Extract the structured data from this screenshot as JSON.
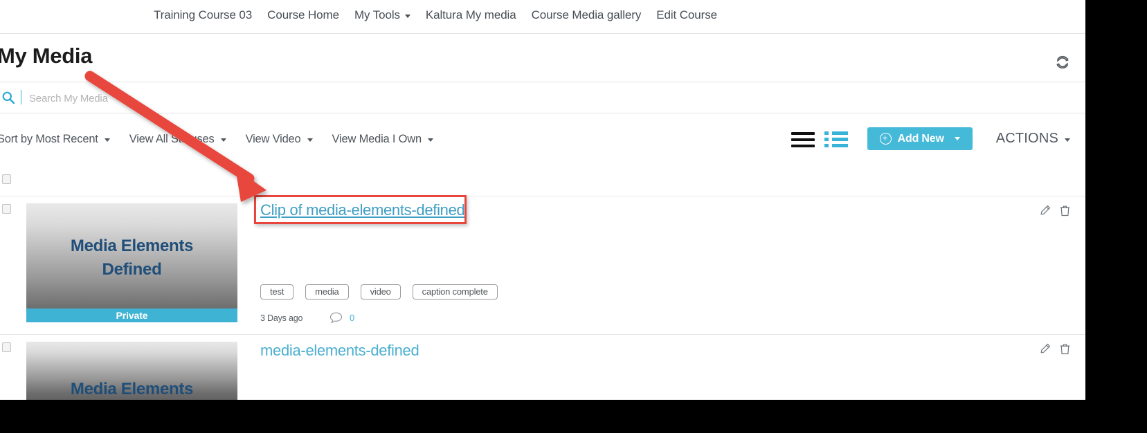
{
  "topnav": {
    "items": [
      {
        "label": "Training Course 03",
        "caret": false
      },
      {
        "label": "Course Home",
        "caret": false
      },
      {
        "label": "My Tools",
        "caret": true
      },
      {
        "label": "Kaltura My media",
        "caret": false
      },
      {
        "label": "Course Media gallery",
        "caret": false
      },
      {
        "label": "Edit Course",
        "caret": false
      }
    ]
  },
  "header": {
    "title": "My Media",
    "refresh_icon": "refresh-icon"
  },
  "search": {
    "icon": "search-icon",
    "placeholder": "Search My Media",
    "value": ""
  },
  "toolbar": {
    "filters": [
      {
        "label": "Sort by Most Recent"
      },
      {
        "label": "View All Statuses"
      },
      {
        "label": "View Video"
      },
      {
        "label": "View Media I Own"
      }
    ],
    "view_list_icon": "list-view-icon",
    "view_detail_icon": "detail-view-icon",
    "add_new_label": "Add New",
    "add_new_icon": "plus-circle-icon",
    "actions_label": "ACTIONS",
    "accent_color": "#45b9d8"
  },
  "media_items": [
    {
      "title": "Clip of media-elements-defined",
      "thumbnail_text": "Media Elements\nDefined",
      "thumbnail_line1": "Media Elements",
      "thumbnail_line2": "Defined",
      "privacy_badge": "Private",
      "tags": [
        "test",
        "media",
        "video",
        "caption complete"
      ],
      "date": "3 Days ago",
      "comment_count": "0",
      "comment_icon": "comment-bubble-icon",
      "edit_icon": "pencil-icon",
      "delete_icon": "trash-icon"
    },
    {
      "title": "media-elements-defined",
      "thumbnail_line1": "Media Elements",
      "edit_icon": "pencil-icon",
      "delete_icon": "trash-icon"
    }
  ],
  "annotation": {
    "arrow_color": "#e8463c",
    "highlight_color": "#e8463c",
    "target": "Clip of media-elements-defined"
  }
}
